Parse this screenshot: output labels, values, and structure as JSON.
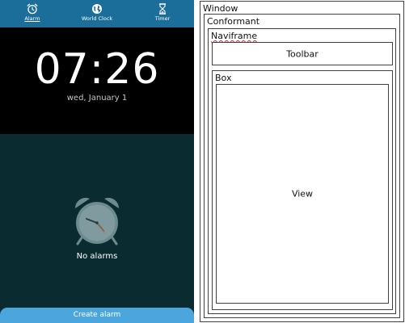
{
  "tabs": [
    {
      "label": "Alarm",
      "icon": "alarm-clock-icon",
      "active": true
    },
    {
      "label": "World Clock",
      "icon": "globe-icon",
      "active": false
    },
    {
      "label": "Timer",
      "icon": "hourglass-icon",
      "active": false
    }
  ],
  "clock": {
    "time": "07:26",
    "date": "wed, January 1"
  },
  "empty_state": {
    "icon": "alarm-clock-icon",
    "message": "No alarms"
  },
  "create_button": {
    "label": "Create alarm"
  },
  "layout_diagram": {
    "window": "Window",
    "conformant": "Conformant",
    "naviframe": "Naviframe",
    "toolbar": "Toolbar",
    "box": "Box",
    "view": "View"
  },
  "colors": {
    "tab_bar": "#1b6d9a",
    "clock_bg": "#000000",
    "content_bg": "#0a2c31",
    "button_bg": "#4aa6dc"
  }
}
